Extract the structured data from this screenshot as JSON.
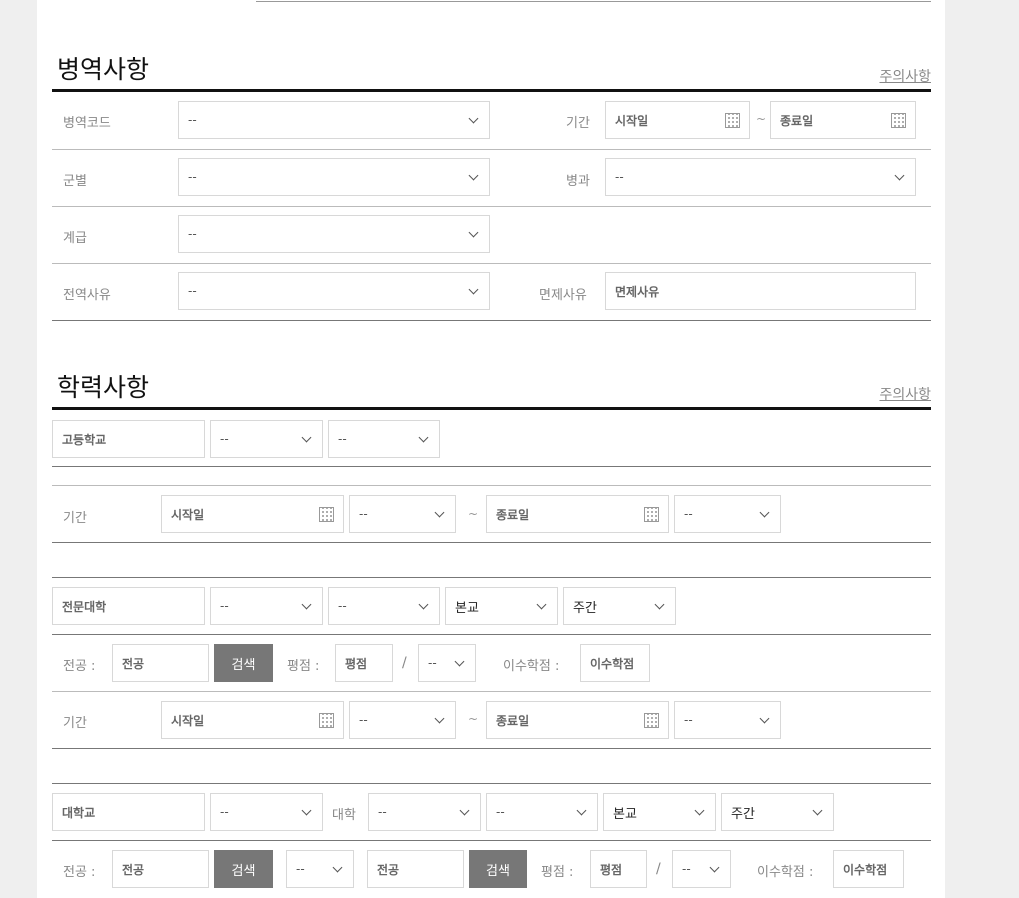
{
  "military": {
    "title": "병역사항",
    "caution_link": "주의사항",
    "code_label": "병역코드",
    "code_value": "--",
    "period_label": "기간",
    "start_placeholder": "시작일",
    "end_placeholder": "종료일",
    "tilde": "~",
    "branch_label": "군별",
    "branch_value": "--",
    "specialty_label": "병과",
    "specialty_value": "--",
    "rank_label": "계급",
    "rank_value": "--",
    "discharge_label": "전역사유",
    "discharge_value": "--",
    "exemption_label": "면제사유",
    "exemption_placeholder": "면제사유"
  },
  "education": {
    "title": "학력사항",
    "caution_link": "주의사항",
    "high_school": {
      "name_placeholder": "고등학교",
      "select1": "--",
      "select2": "--",
      "period_label": "기간",
      "start_placeholder": "시작일",
      "start_status": "--",
      "tilde": "~",
      "end_placeholder": "종료일",
      "end_status": "--"
    },
    "college": {
      "name_placeholder": "전문대학",
      "select1": "--",
      "select2": "--",
      "campus": "본교",
      "shift": "주간",
      "major_label": "전공 :",
      "major_placeholder": "전공",
      "search_button": "검색",
      "gpa_label": "평점 :",
      "gpa_placeholder": "평점",
      "slash": "/",
      "gpa_scale": "--",
      "credits_label": "이수학점 :",
      "credits_placeholder": "이수학점",
      "period_label": "기간",
      "start_placeholder": "시작일",
      "start_status": "--",
      "tilde": "~",
      "end_placeholder": "종료일",
      "end_status": "--"
    },
    "university": {
      "name_placeholder": "대학교",
      "select1": "--",
      "college_label": "대학",
      "college_select": "--",
      "select3": "--",
      "campus": "본교",
      "shift": "주간",
      "major_label": "전공 :",
      "major_placeholder": "전공",
      "search_button": "검색",
      "major2_select": "--",
      "major2_placeholder": "전공",
      "search2_button": "검색",
      "gpa_label": "평점 :",
      "gpa_placeholder": "평점",
      "slash": "/",
      "gpa_scale": "--",
      "credits_label": "이수학점 :",
      "credits_placeholder": "이수학점"
    }
  }
}
